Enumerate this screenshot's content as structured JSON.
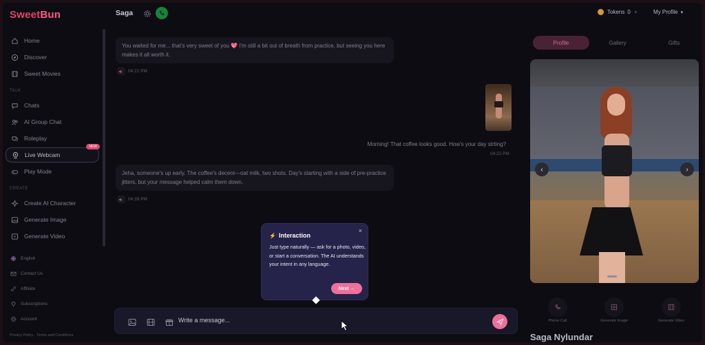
{
  "app": {
    "logo_left": "Sweet",
    "logo_right": "Bun",
    "accent": "#e4446a"
  },
  "sidebar": {
    "main_items": [
      {
        "label": "Home",
        "icon": "home-icon"
      },
      {
        "label": "Discover",
        "icon": "compass-icon"
      },
      {
        "label": "Sweet Movies",
        "icon": "film-icon"
      }
    ],
    "section_talk": "TALK",
    "talk_items": [
      {
        "label": "Chats",
        "icon": "chat-bubble-icon"
      },
      {
        "label": "AI Group Chat",
        "icon": "group-icon"
      },
      {
        "label": "Roleplay",
        "icon": "masks-icon"
      },
      {
        "label": "Live Webcam",
        "icon": "webcam-icon",
        "badge": "NEW",
        "active": true
      },
      {
        "label": "Play Mode",
        "icon": "gamepad-icon"
      }
    ],
    "section_create": "CREATE",
    "create_items": [
      {
        "label": "Create AI Character",
        "icon": "sparkle-icon"
      },
      {
        "label": "Generate Image",
        "icon": "image-icon"
      },
      {
        "label": "Generate Video",
        "icon": "video-icon"
      }
    ],
    "bottom_items": [
      {
        "label": "English",
        "icon": "flag-icon"
      },
      {
        "label": "Contact Us",
        "icon": "mail-icon"
      },
      {
        "label": "Affiliate",
        "icon": "link-icon"
      },
      {
        "label": "Subscriptions",
        "icon": "diamond-icon"
      },
      {
        "label": "Account",
        "icon": "gear-icon"
      }
    ],
    "footer": "Privacy Policy  ·  Terms and Conditions"
  },
  "header": {
    "chat_name": "Saga",
    "tokens_label": "Tokens",
    "tokens_value": "0",
    "tokens_plus": "+",
    "my_profile": "My Profile"
  },
  "messages": [
    {
      "from": "ai",
      "text": "You waited for me... that's very sweet of you 💖 I'm still a bit out of breath from practice, but seeing you here makes it all worth it.",
      "time": "04:22 PM"
    },
    {
      "from": "user",
      "text": "Morning! That coffee looks good. How's your day strting?",
      "time": "04:22 PM"
    },
    {
      "from": "ai",
      "text": "Jeha, someone's up early. The coffee's decent—oat milk, two shots. Day's starting with a side of pre-practice jitters, but your message helped calm them down.",
      "time": "04:39 PM"
    }
  ],
  "input": {
    "placeholder": "Write a message..."
  },
  "tooltip": {
    "title": "Interaction",
    "body": "Just type naturally — ask for a photo, video, or start a conversation. The AI understands your intent in any language.",
    "next": "Next →",
    "close": "×"
  },
  "right_panel": {
    "tabs": [
      "Profile",
      "Gallery",
      "Gifts"
    ],
    "active_tab": "Profile",
    "actions": [
      {
        "label": "Phone Call",
        "icon": "phone-icon"
      },
      {
        "label": "Generate Image",
        "icon": "image-icon"
      },
      {
        "label": "Generate Video",
        "icon": "film-icon"
      }
    ],
    "character_name": "Saga Nylundar"
  }
}
